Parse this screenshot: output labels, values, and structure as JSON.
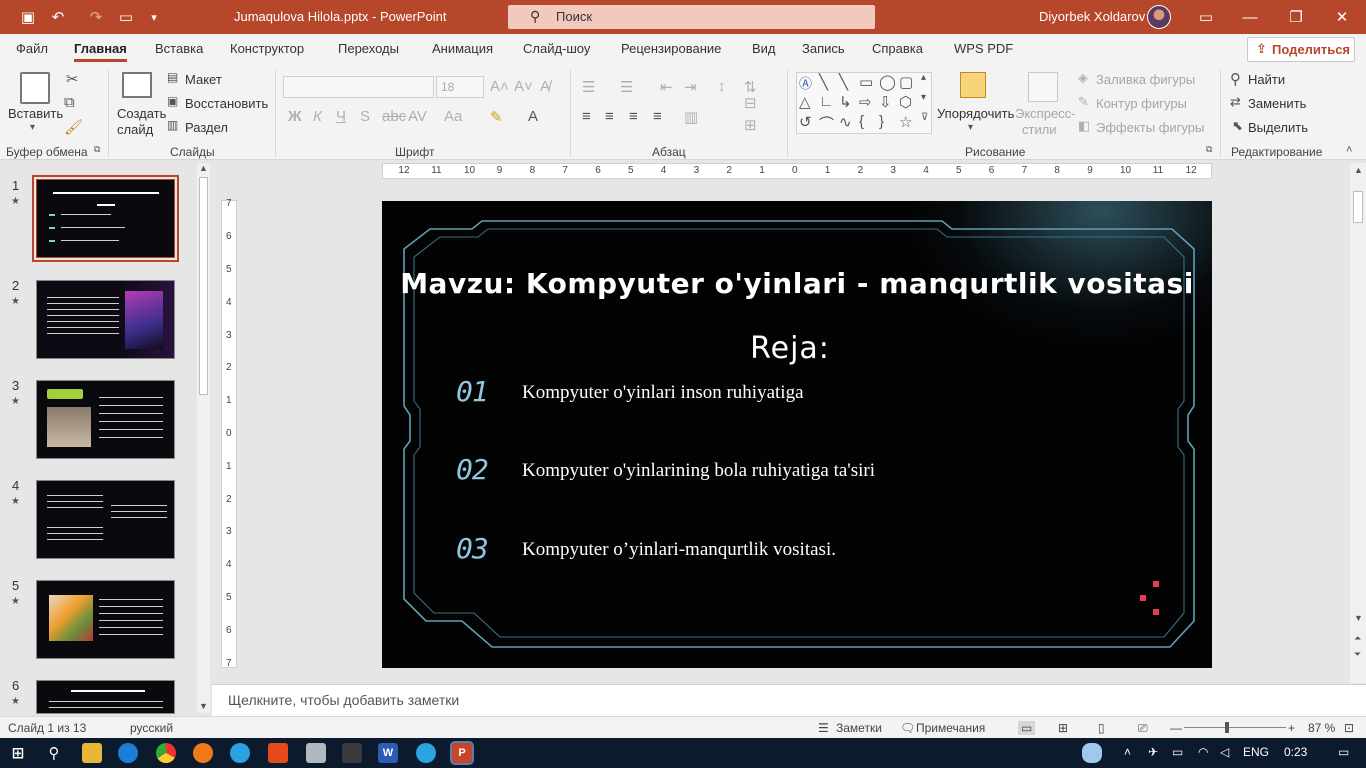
{
  "window": {
    "doc_title": "Jumaqulova Hilola.pptx  -  PowerPoint",
    "search_placeholder": "Поиск",
    "user_name": "Diyorbek Xoldarov"
  },
  "menu": {
    "tabs": [
      "Файл",
      "Главная",
      "Вставка",
      "Конструктор",
      "Переходы",
      "Анимация",
      "Слайд-шоу",
      "Рецензирование",
      "Вид",
      "Запись",
      "Справка",
      "WPS PDF"
    ],
    "share": "Поделиться"
  },
  "ribbon": {
    "clipboard": {
      "paste": "Вставить",
      "label": "Буфер обмена"
    },
    "slides": {
      "new_slide_1": "Создать",
      "new_slide_2": "слайд",
      "layout": "Макет",
      "reset": "Восстановить",
      "section": "Раздел",
      "label": "Слайды"
    },
    "font": {
      "name": "",
      "size": "18",
      "label": "Шрифт"
    },
    "paragraph": {
      "label": "Абзац"
    },
    "drawing": {
      "arrange": "Упорядочить",
      "quick_styles_1": "Экспресс-",
      "quick_styles_2": "стили",
      "fill": "Заливка фигуры",
      "outline": "Контур фигуры",
      "effects": "Эффекты фигуры",
      "label": "Рисование"
    },
    "editing": {
      "find": "Найти",
      "replace": "Заменить",
      "select": "Выделить",
      "label": "Редактирование"
    }
  },
  "thumbnails": [
    {
      "num": "1",
      "selected": true
    },
    {
      "num": "2",
      "selected": false
    },
    {
      "num": "3",
      "selected": false
    },
    {
      "num": "4",
      "selected": false
    },
    {
      "num": "5",
      "selected": false
    },
    {
      "num": "6",
      "selected": false
    }
  ],
  "slide": {
    "title": "Mavzu: Kompyuter o'yinlari - manqurtlik vositasi",
    "subtitle": "Reja:",
    "items": [
      {
        "num": "01",
        "text": "Kompyuter o'yinlari inson ruhiyatiga"
      },
      {
        "num": "02",
        "text": "Kompyuter o'yinlarining bola ruhiyatiga ta'siri"
      },
      {
        "num": "03",
        "text": "Kompyuter o’yinlari-manqurtlik vositasi."
      }
    ]
  },
  "notes_placeholder": "Щелкните, чтобы добавить заметки",
  "status": {
    "slide_of": "Слайд 1 из 13",
    "language": "русский",
    "notes": "Заметки",
    "comments": "Примечания",
    "zoom": "87 %"
  },
  "taskbar": {
    "lang": "ENG",
    "time": "0:23"
  },
  "colors": {
    "accent": "#b7472a",
    "slide_bg": "#030304",
    "slide_frame": "#5f9fb6",
    "number_color": "#8fc7dd"
  }
}
